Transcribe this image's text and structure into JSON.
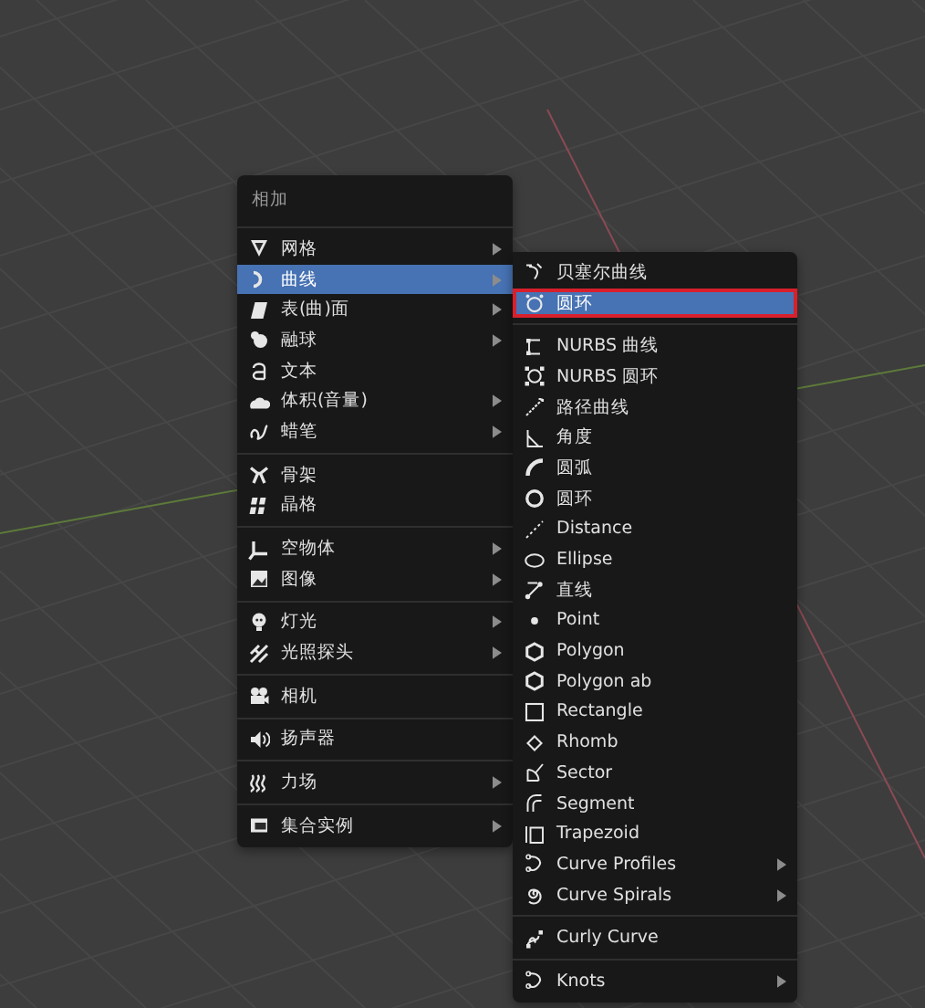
{
  "add_menu": {
    "title": "相加",
    "groups": [
      [
        {
          "label": "网格",
          "submenu": true,
          "selected": false
        },
        {
          "label": "曲线",
          "submenu": true,
          "selected": true
        },
        {
          "label": "表(曲)面",
          "submenu": true,
          "selected": false
        },
        {
          "label": "融球",
          "submenu": true,
          "selected": false
        },
        {
          "label": "文本",
          "submenu": false,
          "selected": false
        },
        {
          "label": "体积(音量)",
          "submenu": true,
          "selected": false
        },
        {
          "label": "蜡笔",
          "submenu": true,
          "selected": false
        }
      ],
      [
        {
          "label": "骨架",
          "submenu": false,
          "selected": false
        },
        {
          "label": "晶格",
          "submenu": false,
          "selected": false
        }
      ],
      [
        {
          "label": "空物体",
          "submenu": true,
          "selected": false
        },
        {
          "label": "图像",
          "submenu": true,
          "selected": false
        }
      ],
      [
        {
          "label": "灯光",
          "submenu": true,
          "selected": false
        },
        {
          "label": "光照探头",
          "submenu": true,
          "selected": false
        }
      ],
      [
        {
          "label": "相机",
          "submenu": false,
          "selected": false
        }
      ],
      [
        {
          "label": "扬声器",
          "submenu": false,
          "selected": false
        }
      ],
      [
        {
          "label": "力场",
          "submenu": true,
          "selected": false
        }
      ],
      [
        {
          "label": "集合实例",
          "submenu": true,
          "selected": false
        }
      ]
    ]
  },
  "curve_menu": {
    "groups": [
      [
        {
          "label": "贝塞尔曲线",
          "submenu": false,
          "selected": false,
          "outlined": false
        },
        {
          "label": "圆环",
          "submenu": false,
          "selected": true,
          "outlined": true
        }
      ],
      [
        {
          "label": "NURBS 曲线",
          "submenu": false,
          "selected": false,
          "outlined": false
        },
        {
          "label": "NURBS 圆环",
          "submenu": false,
          "selected": false,
          "outlined": false
        },
        {
          "label": "路径曲线",
          "submenu": false,
          "selected": false,
          "outlined": false
        },
        {
          "label": "角度",
          "submenu": false,
          "selected": false,
          "outlined": false
        },
        {
          "label": "圆弧",
          "submenu": false,
          "selected": false,
          "outlined": false
        },
        {
          "label": "圆环",
          "submenu": false,
          "selected": false,
          "outlined": false
        },
        {
          "label": "Distance",
          "submenu": false,
          "selected": false,
          "outlined": false
        },
        {
          "label": "Ellipse",
          "submenu": false,
          "selected": false,
          "outlined": false
        },
        {
          "label": "直线",
          "submenu": false,
          "selected": false,
          "outlined": false
        },
        {
          "label": "Point",
          "submenu": false,
          "selected": false,
          "outlined": false
        },
        {
          "label": "Polygon",
          "submenu": false,
          "selected": false,
          "outlined": false
        },
        {
          "label": "Polygon ab",
          "submenu": false,
          "selected": false,
          "outlined": false
        },
        {
          "label": "Rectangle",
          "submenu": false,
          "selected": false,
          "outlined": false
        },
        {
          "label": "Rhomb",
          "submenu": false,
          "selected": false,
          "outlined": false
        },
        {
          "label": "Sector",
          "submenu": false,
          "selected": false,
          "outlined": false
        },
        {
          "label": "Segment",
          "submenu": false,
          "selected": false,
          "outlined": false
        },
        {
          "label": "Trapezoid",
          "submenu": false,
          "selected": false,
          "outlined": false
        },
        {
          "label": "Curve Profiles",
          "submenu": true,
          "selected": false,
          "outlined": false
        },
        {
          "label": "Curve Spirals",
          "submenu": true,
          "selected": false,
          "outlined": false
        }
      ],
      [
        {
          "label": "Curly Curve",
          "submenu": false,
          "selected": false,
          "outlined": false
        }
      ],
      [
        {
          "label": "Knots",
          "submenu": true,
          "selected": false,
          "outlined": false
        }
      ]
    ]
  }
}
